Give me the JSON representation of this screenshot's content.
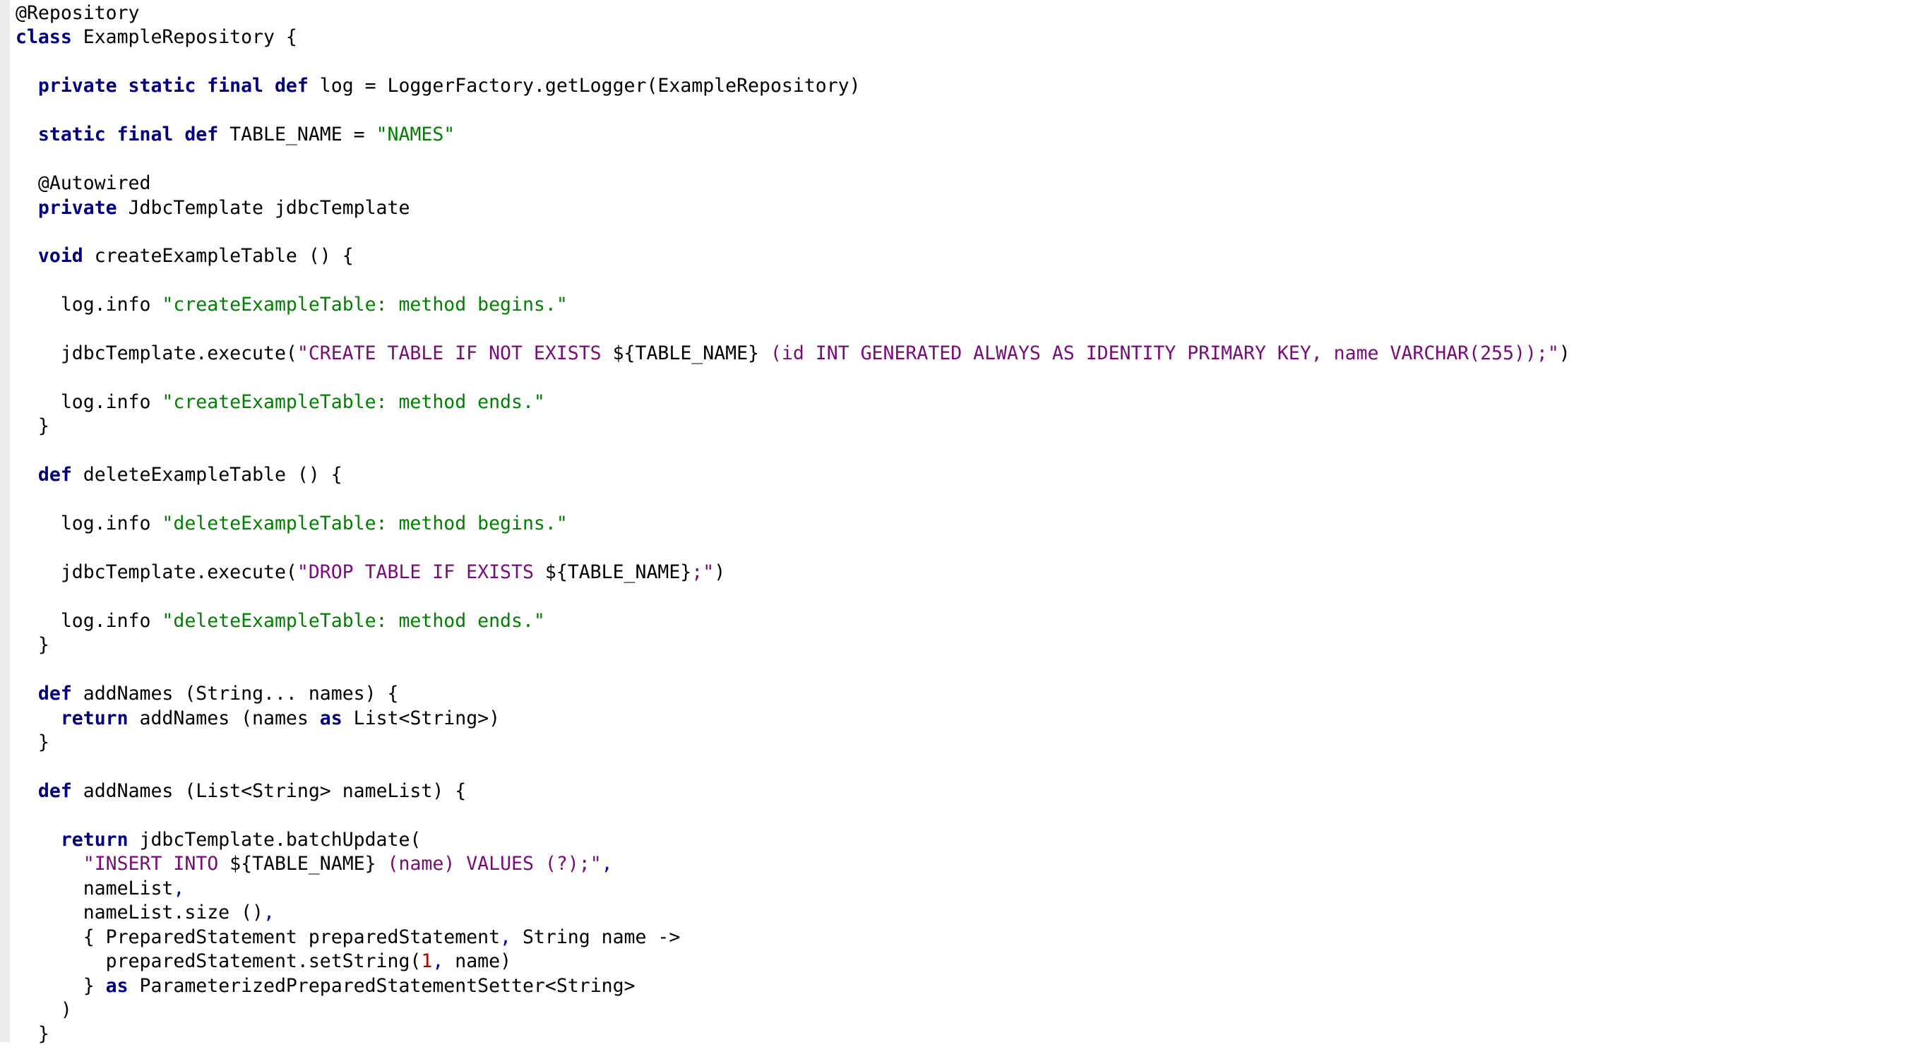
{
  "editor": {
    "language": "groovy",
    "colors": {
      "keyword": "#000080",
      "string": "#008000",
      "sql_string": "#7a0a7a",
      "punctuation": "#0000b0",
      "number": "#b00000",
      "plain": "#000000",
      "gutter": "#ececec",
      "background": "#ffffff"
    },
    "lines": [
      [
        [
          "ann",
          "@Repository"
        ]
      ],
      [
        [
          "kw",
          "class"
        ],
        [
          "plain",
          " ExampleRepository {"
        ]
      ],
      [],
      [
        [
          "plain",
          "  "
        ],
        [
          "kw",
          "private static final def"
        ],
        [
          "plain",
          " log = LoggerFactory.getLogger(ExampleRepository)"
        ]
      ],
      [],
      [
        [
          "plain",
          "  "
        ],
        [
          "kw",
          "static final def"
        ],
        [
          "plain",
          " TABLE_NAME = "
        ],
        [
          "str",
          "\"NAMES\""
        ]
      ],
      [],
      [
        [
          "ann",
          "  @Autowired"
        ]
      ],
      [
        [
          "plain",
          "  "
        ],
        [
          "kw",
          "private"
        ],
        [
          "plain",
          " JdbcTemplate jdbcTemplate"
        ]
      ],
      [],
      [
        [
          "plain",
          "  "
        ],
        [
          "kw",
          "void"
        ],
        [
          "plain",
          " createExampleTable () {"
        ]
      ],
      [],
      [
        [
          "plain",
          "    log.info "
        ],
        [
          "str",
          "\"createExampleTable: method begins.\""
        ]
      ],
      [],
      [
        [
          "plain",
          "    jdbcTemplate.execute("
        ],
        [
          "sql",
          "\"CREATE TABLE IF NOT EXISTS "
        ],
        [
          "plain",
          "${TABLE_NAME}"
        ],
        [
          "sql",
          " (id INT GENERATED ALWAYS AS IDENTITY PRIMARY KEY, name VARCHAR(255));\""
        ],
        [
          "plain",
          ")"
        ]
      ],
      [],
      [
        [
          "plain",
          "    log.info "
        ],
        [
          "str",
          "\"createExampleTable: method ends.\""
        ]
      ],
      [
        [
          "plain",
          "  }"
        ]
      ],
      [],
      [
        [
          "plain",
          "  "
        ],
        [
          "kw",
          "def"
        ],
        [
          "plain",
          " deleteExampleTable () {"
        ]
      ],
      [],
      [
        [
          "plain",
          "    log.info "
        ],
        [
          "str",
          "\"deleteExampleTable: method begins.\""
        ]
      ],
      [],
      [
        [
          "plain",
          "    jdbcTemplate.execute("
        ],
        [
          "sql",
          "\"DROP TABLE IF EXISTS "
        ],
        [
          "plain",
          "${TABLE_NAME}"
        ],
        [
          "sql",
          ";\""
        ],
        [
          "plain",
          ")"
        ]
      ],
      [],
      [
        [
          "plain",
          "    log.info "
        ],
        [
          "str",
          "\"deleteExampleTable: method ends.\""
        ]
      ],
      [
        [
          "plain",
          "  }"
        ]
      ],
      [],
      [
        [
          "plain",
          "  "
        ],
        [
          "kw",
          "def"
        ],
        [
          "plain",
          " addNames (String... names) {"
        ]
      ],
      [
        [
          "plain",
          "    "
        ],
        [
          "kw",
          "return"
        ],
        [
          "plain",
          " addNames (names "
        ],
        [
          "kw",
          "as"
        ],
        [
          "plain",
          " List<String>)"
        ]
      ],
      [
        [
          "plain",
          "  }"
        ]
      ],
      [],
      [
        [
          "plain",
          "  "
        ],
        [
          "kw",
          "def"
        ],
        [
          "plain",
          " addNames (List<String> nameList) {"
        ]
      ],
      [],
      [
        [
          "plain",
          "    "
        ],
        [
          "kw",
          "return"
        ],
        [
          "plain",
          " jdbcTemplate.batchUpdate("
        ]
      ],
      [
        [
          "plain",
          "      "
        ],
        [
          "sql",
          "\"INSERT INTO "
        ],
        [
          "plain",
          "${TABLE_NAME}"
        ],
        [
          "sql",
          " (name) VALUES (?);\""
        ],
        [
          "punct",
          ","
        ]
      ],
      [
        [
          "plain",
          "      nameList"
        ],
        [
          "punct",
          ","
        ]
      ],
      [
        [
          "plain",
          "      nameList.size ()"
        ],
        [
          "punct",
          ","
        ]
      ],
      [
        [
          "plain",
          "      { PreparedStatement preparedStatement"
        ],
        [
          "punct",
          ","
        ],
        [
          "plain",
          " String name ->"
        ]
      ],
      [
        [
          "plain",
          "        preparedStatement.setString("
        ],
        [
          "num",
          "1"
        ],
        [
          "punct",
          ","
        ],
        [
          "plain",
          " name)"
        ]
      ],
      [
        [
          "plain",
          "      } "
        ],
        [
          "kw",
          "as"
        ],
        [
          "plain",
          " ParameterizedPreparedStatementSetter<String>"
        ]
      ],
      [
        [
          "plain",
          "    )"
        ]
      ],
      [
        [
          "plain",
          "  }"
        ]
      ]
    ]
  }
}
